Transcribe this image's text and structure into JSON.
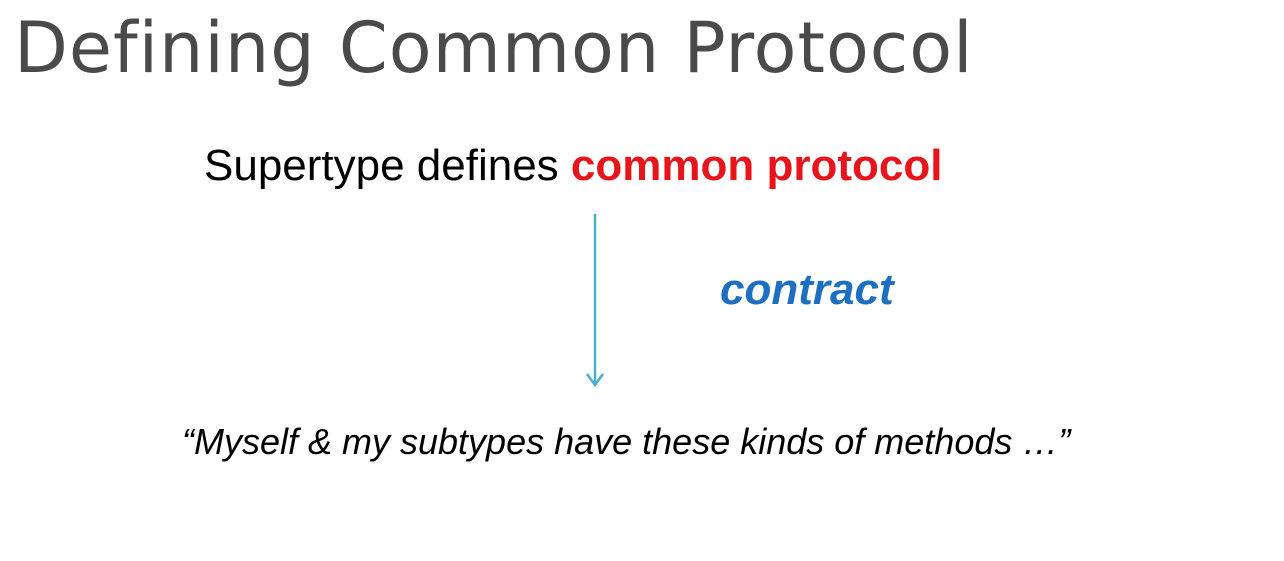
{
  "slide": {
    "title": "Defining Common Protocol",
    "statement": {
      "prefix": "Supertype defines ",
      "highlight": "common protocol"
    },
    "arrow_label": "contract",
    "quote": "“Myself & my subtypes have these kinds of methods …”"
  },
  "colors": {
    "title": "#4a4a4a",
    "highlight": "#e8141c",
    "contract": "#1e6fc1",
    "arrow": "#4bb0c8"
  }
}
